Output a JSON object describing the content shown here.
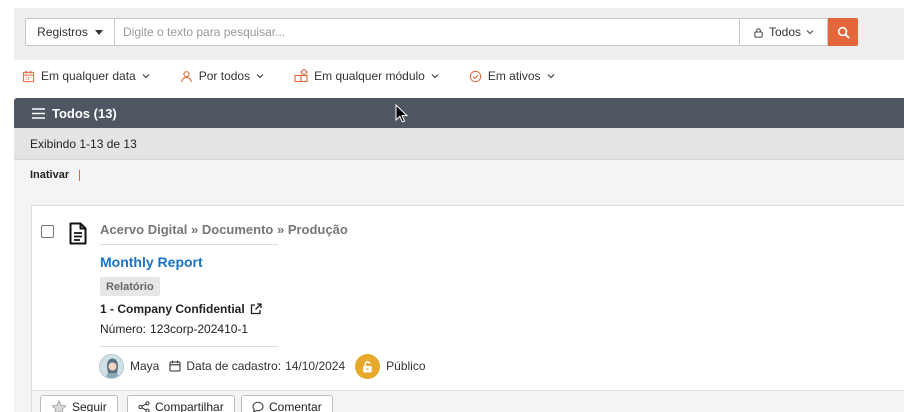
{
  "search": {
    "scope_label": "Registros",
    "placeholder": "Digite o texto para pesquisar...",
    "value": "",
    "visibility_label": "Todos"
  },
  "filters": [
    {
      "label": "Em qualquer data",
      "icon": "calendar-icon"
    },
    {
      "label": "Por todos",
      "icon": "user-icon"
    },
    {
      "label": "Em qualquer módulo",
      "icon": "modules-icon"
    },
    {
      "label": "Em ativos",
      "icon": "check-circle-icon"
    }
  ],
  "list": {
    "header": "Todos (13)",
    "showing": "Exibindo 1-13 de 13",
    "bulk_action": "Inativar"
  },
  "record": {
    "breadcrumb": "Acervo Digital » Documento » Produção",
    "title": "Monthly Report",
    "type_badge": "Relatório",
    "classification": "1 - Company Confidential",
    "numero_label": "Número:",
    "numero_value": "123corp-202410-1",
    "author": "Maya",
    "date_label": "Data de cadastro:",
    "date_value": "14/10/2024",
    "visibility": "Público"
  },
  "card_actions": {
    "follow": "Seguir",
    "share": "Compartilhar",
    "comment": "Comentar"
  },
  "colors": {
    "accent": "#e4663a",
    "header_bg": "#4e5762",
    "link": "#1a73c8",
    "lock_badge": "#e7a92c"
  }
}
